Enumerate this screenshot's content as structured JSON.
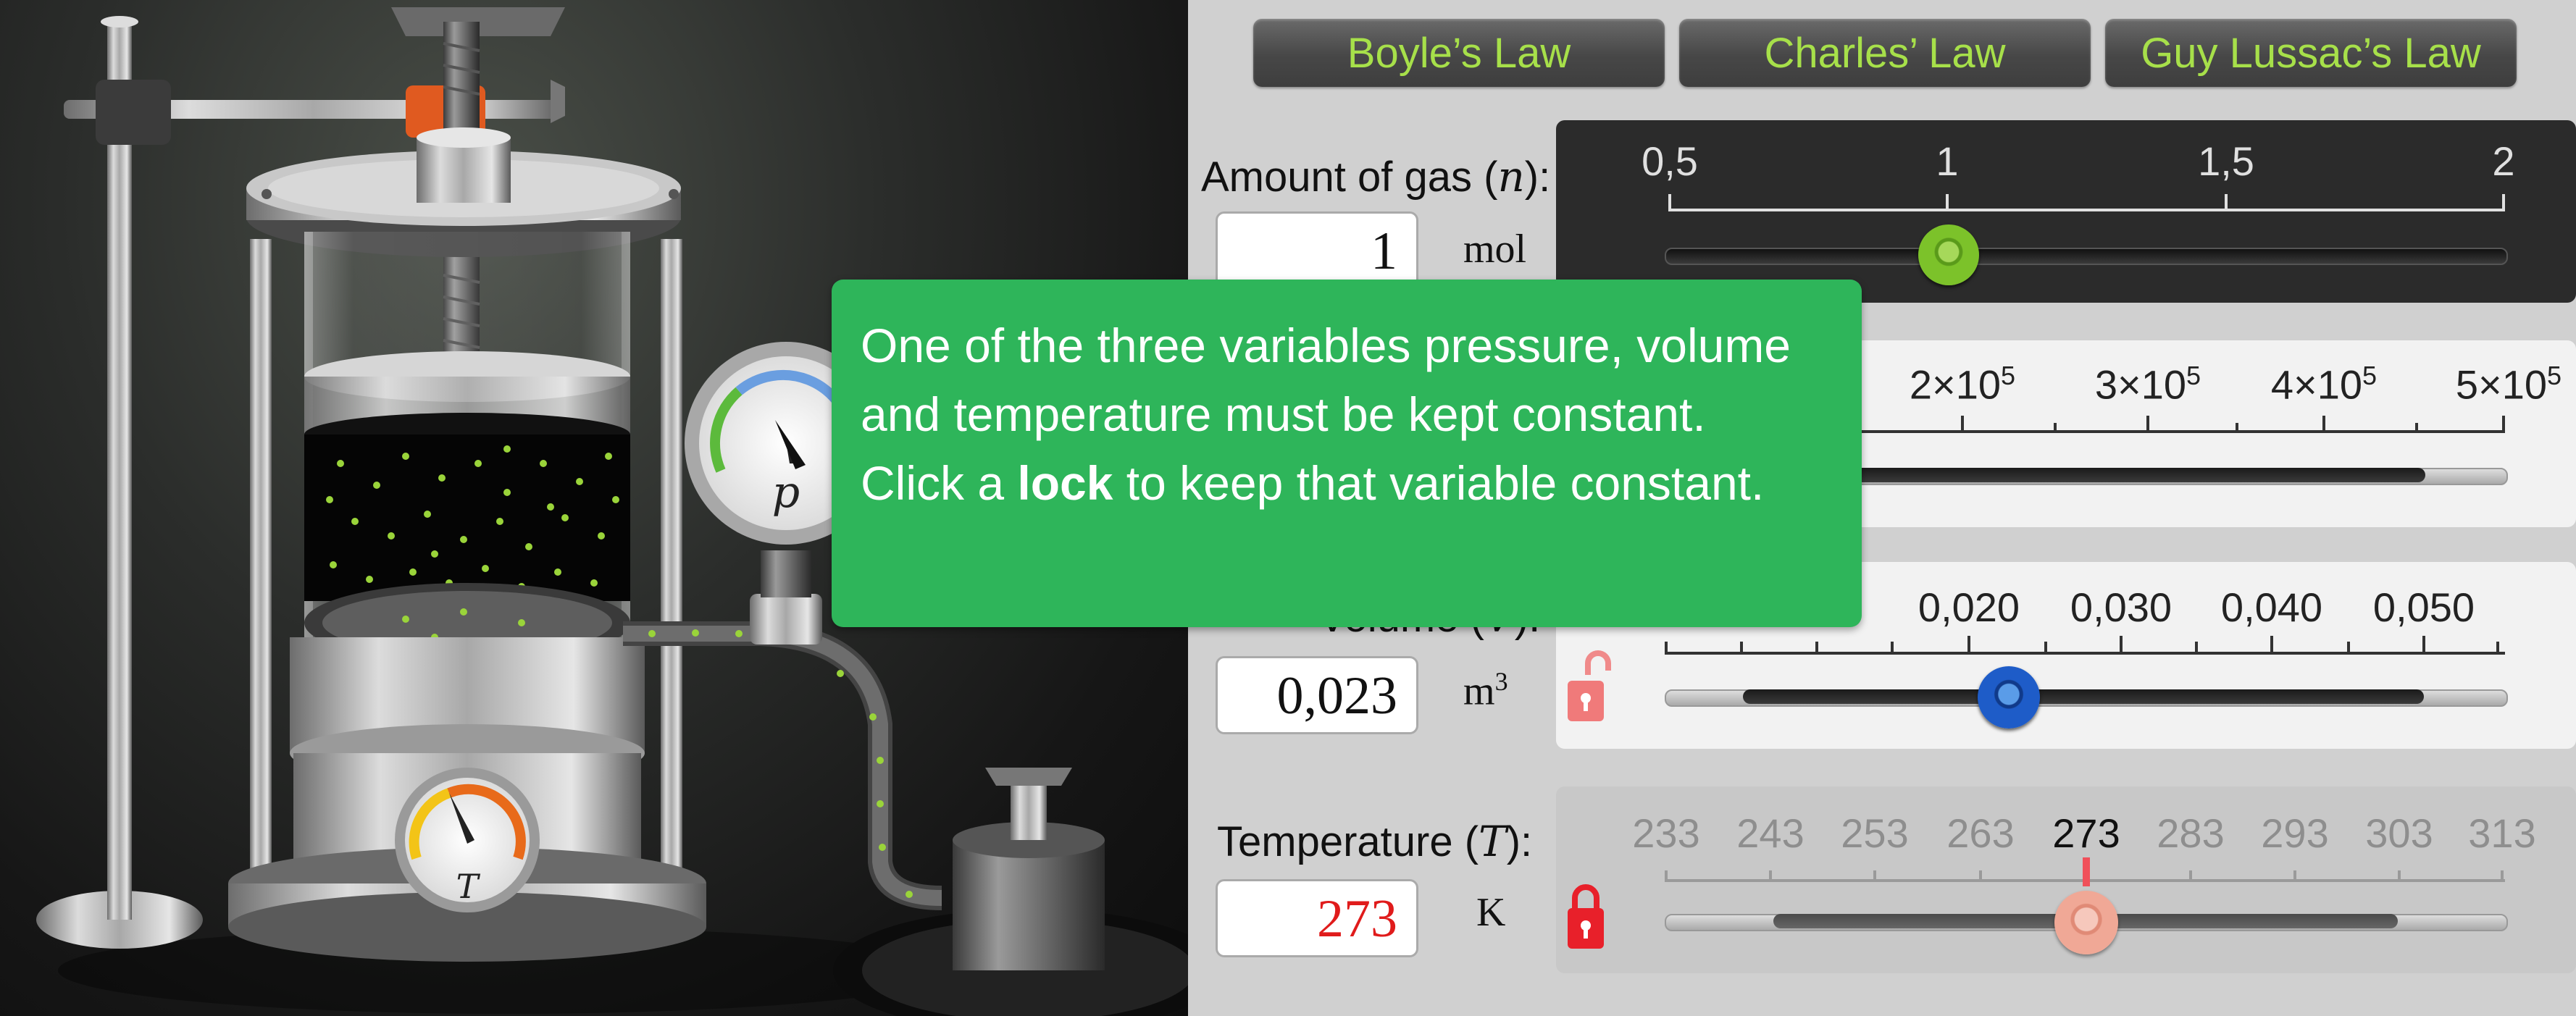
{
  "tabs": [
    "Boyle’s Law",
    "Charles’ Law",
    "Guy Lussac’s Law"
  ],
  "amount": {
    "label": "Amount of gas",
    "symbol": "n",
    "value": "1",
    "unit": "mol",
    "ticks": [
      "0,5",
      "1",
      "1,5",
      "2"
    ],
    "slider_fraction": 0.333
  },
  "pressure": {
    "ticks": [
      [
        "2×10",
        "5"
      ],
      [
        "3×10",
        "5"
      ],
      [
        "4×10",
        "5"
      ],
      [
        "5×10",
        "5"
      ]
    ]
  },
  "volume": {
    "label": "Volume",
    "symbol": "V",
    "value": "0,023",
    "unit": "m",
    "unit_exp": "3",
    "ticks": [
      "0,020",
      "0,030",
      "0,040",
      "0,050"
    ],
    "locked": false
  },
  "temperature": {
    "label": "Temperature",
    "symbol": "T",
    "value": "273",
    "unit": "K",
    "ticks": [
      "233",
      "243",
      "253",
      "263",
      "273",
      "283",
      "293",
      "303",
      "313"
    ],
    "current_tick": "273",
    "locked": true,
    "value_color": "#e01b1b"
  },
  "overlay": {
    "line1": "One of the three variables pressure, volume",
    "line2": "and temperature must be kept constant.",
    "line3_pre": "Click a ",
    "line3_bold": "lock",
    "line3_post": " to keep that variable constant."
  },
  "gauges": {
    "pressure_symbol": "p",
    "temperature_symbol": "T"
  },
  "colors": {
    "tab_text": "#a7e04a",
    "overlay": "#2eb55a",
    "lock": "#e8202a",
    "molecule": "#9ad43a",
    "amount_knob": "#7cc22a",
    "volume_knob": "#1e5cc8",
    "temperature_knob": "#f0a896"
  }
}
